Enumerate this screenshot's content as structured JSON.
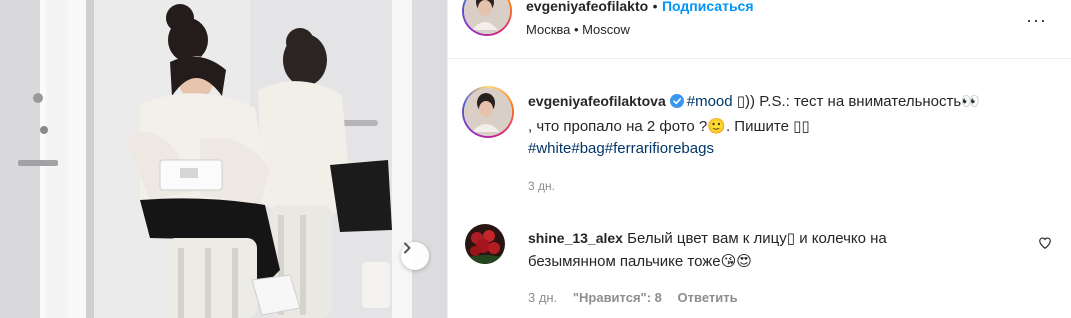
{
  "post": {
    "author": "evgeniyafeofilakto",
    "author_full": "evgeniyafeofilaktova",
    "follow_label": "Подписаться",
    "separator": "•",
    "location": "Москва • Moscow",
    "more_label": "···"
  },
  "caption": {
    "tag_mood": "#mood",
    "box1": "▯",
    "text_after_mood": ")) P.S.: тест на внимательность",
    "eyes": "👀",
    "line2": ", что пропало на 2 фото ?",
    "smile": "🙂",
    "line2b": ". Пишите ",
    "box2": "▯▯",
    "tag_white": "#white",
    "tag_bag": "#bag",
    "tag_ferrari": "#ferrarifiorebags",
    "time": "3 дн."
  },
  "comment": {
    "user": "shine_13_alex",
    "text1": "Белый цвет вам к лицу",
    "box": "▯",
    "text2": " и колечко на",
    "line2": "безымянном пальчике тоже",
    "emoji1": "😘",
    "emoji2": "😍",
    "time": "3 дн.",
    "likes": "\"Нравится\": 8",
    "reply": "Ответить"
  },
  "colors": {
    "link": "#0095f6",
    "hashtag": "#00376b",
    "muted": "#8e8e8e",
    "verified": "#3897f0"
  },
  "icons": [
    "chevron-right-icon",
    "verified-badge-icon",
    "heart-icon",
    "more-icon"
  ]
}
